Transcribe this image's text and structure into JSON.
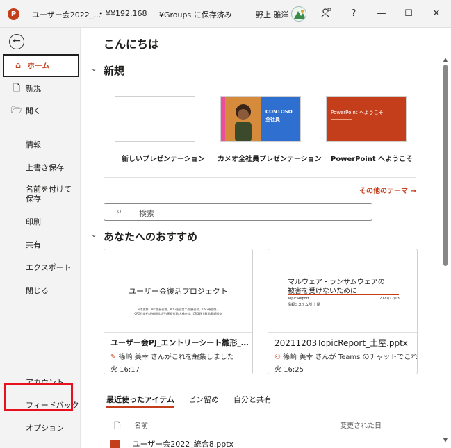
{
  "title_bar": {
    "app_logo": "P",
    "file_name": "ユーザー会2022_…",
    "path": "• ¥¥192.168",
    "save_status": "¥Groups に保存済み",
    "user_name": "野上 雅洋",
    "help": "?",
    "minimize": "—",
    "maximize": "☐",
    "close": "✕"
  },
  "sidebar": {
    "back": "←",
    "primary": [
      {
        "label": "ホーム",
        "icon": "home-icon",
        "glyph": "⌂"
      },
      {
        "label": "新規",
        "icon": "new-file-icon",
        "glyph": "🗋"
      },
      {
        "label": "開く",
        "icon": "folder-open-icon",
        "glyph": "🗁"
      }
    ],
    "secondary": [
      "情報",
      "上書き保存",
      "名前を付けて保存",
      "印刷",
      "共有",
      "エクスポート",
      "閉じる"
    ],
    "bottom": [
      "アカウント",
      "フィードバック",
      "オプション"
    ]
  },
  "main": {
    "greeting": "こんにちは",
    "new_section": {
      "heading": "新規",
      "templates": [
        {
          "label": "新しいプレゼンテーション"
        },
        {
          "label": "カメオ全社員プレゼンテーション",
          "thumb_title": "CONTOSO",
          "thumb_sub": "全社員"
        },
        {
          "label": "PowerPoint へようこそ",
          "thumb_title": "PowerPoint へようこそ"
        }
      ],
      "more_themes": "その他のテーマ →"
    },
    "search": {
      "placeholder": "検索"
    },
    "recommended": {
      "heading": "あなたへのおすすめ",
      "cards": [
        {
          "preview_title": "ユーザー会復活プロジェクト",
          "preview_line1": "岡本史郎、AIO佐藤秀雄、POG飯谷賢二/加藤秀武、DSG寺西朗、",
          "preview_line2": "CPG作道祐計/鶴間欣記子/黒柳秀晃/大橋宰佳、CRG野上雅洋/篠崎美幸",
          "title": "ユーザー会PJ_エントリーシート雛形_…",
          "activity": "篠崎 美幸 さんがこれを編集しました",
          "time": "火 16:17"
        },
        {
          "preview_title_1": "マルウェア・ランサムウェアの",
          "preview_title_2": "被害を受けないために",
          "preview_meta_left": "Topic Report",
          "preview_meta_right": "2021/12/03",
          "preview_author": "情報システム部 土屋",
          "title": "20211203TopicReport_土屋.pptx",
          "activity": "篠崎 美幸 さんが Teams のチャットでこれ…",
          "time": "火 16:25"
        }
      ]
    },
    "tabs": [
      "最近使ったアイテム",
      "ピン留め",
      "自分と共有"
    ],
    "list_headers": {
      "name": "名前",
      "modified": "変更された日"
    },
    "files": [
      {
        "name": "ユーザー会2022_統合8.pptx"
      }
    ]
  },
  "colors": {
    "accent": "#c43e1c",
    "highlight_box": "#e8101e"
  }
}
